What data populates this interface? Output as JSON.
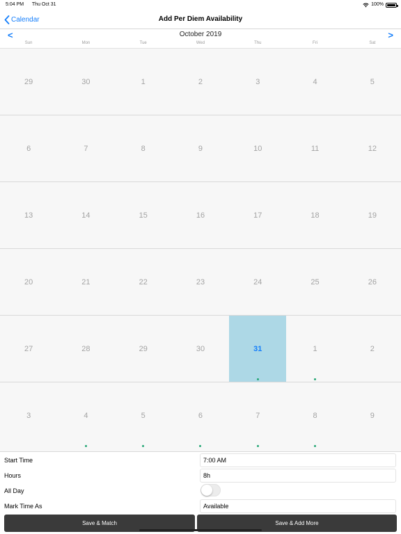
{
  "status_bar": {
    "time": "5:04 PM",
    "date": "Thu Oct 31",
    "battery": "100%"
  },
  "nav": {
    "back_label": "Calendar",
    "title": "Add Per Diem Availability"
  },
  "calendar": {
    "month_title": "October 2019",
    "prev_arrow": "<",
    "next_arrow": ">",
    "weekdays": [
      "Sun",
      "Mon",
      "Tue",
      "Wed",
      "Thu",
      "Fri",
      "Sat"
    ],
    "accent_color": "#147efb",
    "selected_color": "#add8e6",
    "dot_color": "#27a776",
    "weeks": [
      [
        {
          "d": "29"
        },
        {
          "d": "30"
        },
        {
          "d": "1"
        },
        {
          "d": "2"
        },
        {
          "d": "3"
        },
        {
          "d": "4"
        },
        {
          "d": "5"
        }
      ],
      [
        {
          "d": "6"
        },
        {
          "d": "7"
        },
        {
          "d": "8"
        },
        {
          "d": "9"
        },
        {
          "d": "10"
        },
        {
          "d": "11"
        },
        {
          "d": "12"
        }
      ],
      [
        {
          "d": "13"
        },
        {
          "d": "14"
        },
        {
          "d": "15"
        },
        {
          "d": "16"
        },
        {
          "d": "17"
        },
        {
          "d": "18"
        },
        {
          "d": "19"
        }
      ],
      [
        {
          "d": "20"
        },
        {
          "d": "21"
        },
        {
          "d": "22"
        },
        {
          "d": "23"
        },
        {
          "d": "24"
        },
        {
          "d": "25"
        },
        {
          "d": "26"
        }
      ],
      [
        {
          "d": "27"
        },
        {
          "d": "28"
        },
        {
          "d": "29"
        },
        {
          "d": "30"
        },
        {
          "d": "31",
          "selected": true,
          "dot": true
        },
        {
          "d": "1",
          "dot": true
        },
        {
          "d": "2"
        }
      ],
      [
        {
          "d": "3"
        },
        {
          "d": "4",
          "dot": true
        },
        {
          "d": "5",
          "dot": true
        },
        {
          "d": "6",
          "dot": true
        },
        {
          "d": "7",
          "dot": true
        },
        {
          "d": "8",
          "dot": true
        },
        {
          "d": "9"
        }
      ]
    ]
  },
  "form": {
    "start_time_label": "Start Time",
    "start_time_value": "7:00 AM",
    "hours_label": "Hours",
    "hours_value": "8h",
    "all_day_label": "All Day",
    "all_day_on": false,
    "mark_time_label": "Mark Time As",
    "mark_time_value": "Available"
  },
  "buttons": {
    "save_match": "Save & Match",
    "save_add_more": "Save & Add More"
  }
}
